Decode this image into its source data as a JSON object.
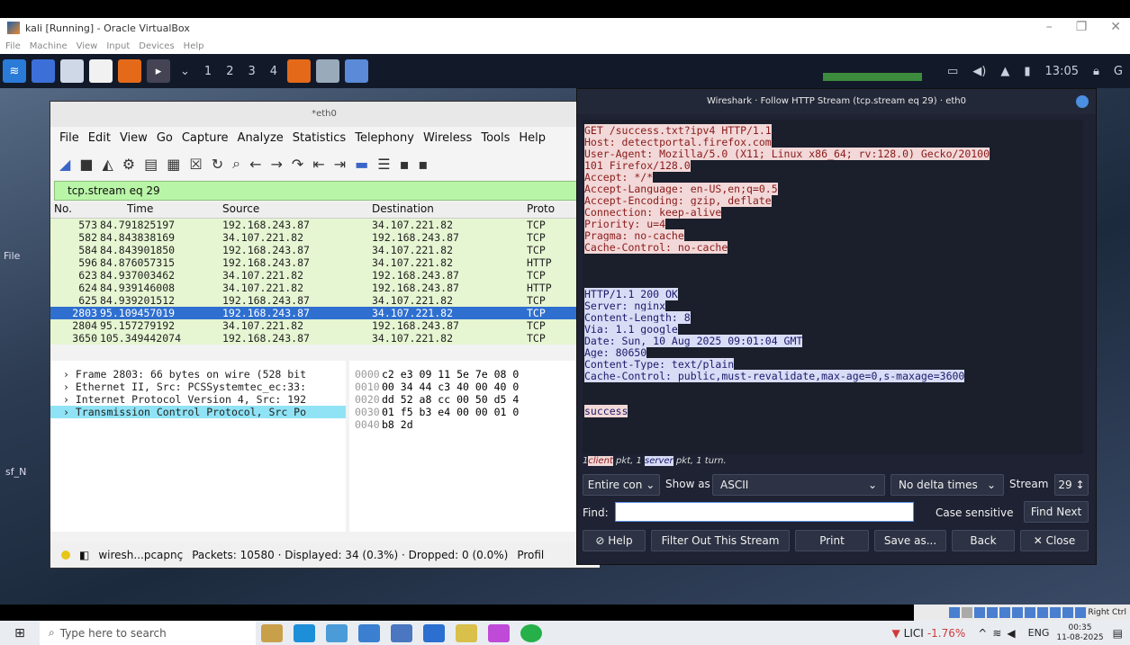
{
  "vbox": {
    "title": "kali [Running] - Oracle VirtualBox",
    "menu": [
      "File",
      "Machine",
      "View",
      "Input",
      "Devices",
      "Help"
    ],
    "host_key": "Right Ctrl"
  },
  "kali_panel": {
    "workspaces": [
      "1",
      "2",
      "3",
      "4"
    ],
    "clock": "13:05"
  },
  "desktop": {
    "icons": [
      "File",
      "sf_N"
    ]
  },
  "wireshark": {
    "title": "*eth0",
    "menu": [
      "File",
      "Edit",
      "View",
      "Go",
      "Capture",
      "Analyze",
      "Statistics",
      "Telephony",
      "Wireless",
      "Tools",
      "Help"
    ],
    "filter": "tcp.stream eq 29",
    "columns": [
      "No.",
      "Time",
      "Source",
      "Destination",
      "Proto"
    ],
    "packets": [
      {
        "no": "573",
        "time": "84.791825197",
        "src": "192.168.243.87",
        "dst": "34.107.221.82",
        "proto": "TCP"
      },
      {
        "no": "582",
        "time": "84.843838169",
        "src": "34.107.221.82",
        "dst": "192.168.243.87",
        "proto": "TCP"
      },
      {
        "no": "584",
        "time": "84.843901850",
        "src": "192.168.243.87",
        "dst": "34.107.221.82",
        "proto": "TCP"
      },
      {
        "no": "596",
        "time": "84.876057315",
        "src": "192.168.243.87",
        "dst": "34.107.221.82",
        "proto": "HTTP"
      },
      {
        "no": "623",
        "time": "84.937003462",
        "src": "34.107.221.82",
        "dst": "192.168.243.87",
        "proto": "TCP"
      },
      {
        "no": "624",
        "time": "84.939146008",
        "src": "34.107.221.82",
        "dst": "192.168.243.87",
        "proto": "HTTP"
      },
      {
        "no": "625",
        "time": "84.939201512",
        "src": "192.168.243.87",
        "dst": "34.107.221.82",
        "proto": "TCP"
      },
      {
        "no": "2803",
        "time": "95.109457019",
        "src": "192.168.243.87",
        "dst": "34.107.221.82",
        "proto": "TCP"
      },
      {
        "no": "2804",
        "time": "95.157279192",
        "src": "34.107.221.82",
        "dst": "192.168.243.87",
        "proto": "TCP"
      },
      {
        "no": "3650",
        "time": "105.349442074",
        "src": "192.168.243.87",
        "dst": "34.107.221.82",
        "proto": "TCP"
      }
    ],
    "details": [
      "Frame 2803: 66 bytes on wire (528 bit",
      "Ethernet II, Src: PCSSystemtec_ec:33:",
      "Internet Protocol Version 4, Src: 192",
      "Transmission Control Protocol, Src Po"
    ],
    "hex": [
      {
        "off": "0000",
        "bytes": "c2 e3 09 11 5e 7e 08 0"
      },
      {
        "off": "0010",
        "bytes": "00 34 44 c3 40 00 40 0"
      },
      {
        "off": "0020",
        "bytes": "dd 52 a8 cc 00 50 d5 4"
      },
      {
        "off": "0030",
        "bytes": "01 f5 b3 e4 00 00 01 0"
      },
      {
        "off": "0040",
        "bytes": "b8 2d"
      }
    ],
    "status_file": "wiresh...pcapnç",
    "status_counts": "Packets: 10580 · Displayed: 34 (0.3%) · Dropped: 0 (0.0%)",
    "status_profile": "Profil"
  },
  "follow": {
    "title": "Wireshark · Follow HTTP Stream (tcp.stream eq 29) · eth0",
    "request": [
      "GET /success.txt?ipv4 HTTP/1.1",
      "Host: detectportal.firefox.com",
      "User-Agent: Mozilla/5.0 (X11; Linux x86_64; rv:128.0) Gecko/20100",
      "101 Firefox/128.0",
      "Accept: */*",
      "Accept-Language: en-US,en;q=0.5",
      "Accept-Encoding: gzip, deflate",
      "Connection: keep-alive",
      "Priority: u=4",
      "Pragma: no-cache",
      "Cache-Control: no-cache"
    ],
    "response": [
      "HTTP/1.1 200 OK",
      "Server: nginx",
      "Content-Length: 8",
      "Via: 1.1 google",
      "Date: Sun, 10 Aug 2025 09:01:04 GMT",
      "Age: 80650",
      "Content-Type: text/plain",
      "Cache-Control: public,must-revalidate,max-age=0,s-maxage=3600"
    ],
    "body": "success",
    "turns_prefix": "1",
    "turns_client": "client",
    "turns_mid": " pkt, 1 ",
    "turns_server": "server",
    "turns_suffix": " pkt, 1 turn.",
    "conversation": "Entire con",
    "show_as_label": "Show as",
    "show_as": "ASCII",
    "delta": "No delta times",
    "stream_label": "Stream",
    "stream": "29",
    "find_label": "Find:",
    "case_sensitive": "Case sensitive",
    "find_next": "Find Next",
    "help": "Help",
    "filter_out": "Filter Out This Stream",
    "print": "Print",
    "save_as": "Save as...",
    "back": "Back",
    "close": "Close"
  },
  "taskbar": {
    "search_placeholder": "Type here to search",
    "stock_name": "LICI",
    "stock_change": "-1.76%",
    "lang": "ENG",
    "time": "00:35",
    "date": "11-08-2025"
  }
}
